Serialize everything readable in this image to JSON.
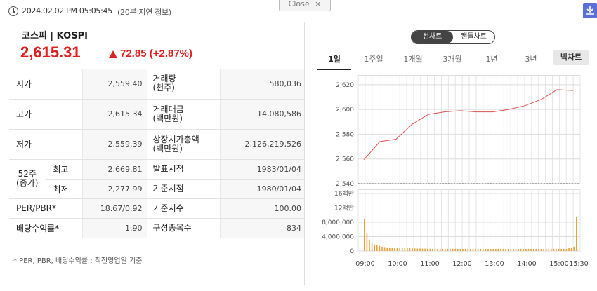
{
  "header": {
    "timestamp": "2024.02.02 PM 05:05:45",
    "delay_note": "(20분 지연 정보)",
    "close_label": "Close",
    "close_glyph": "×"
  },
  "index": {
    "name": "코스피 | KOSPI",
    "value": "2,615.31",
    "change": "72.85",
    "change_pct": "(+2.87%)",
    "up_color": "#e02020"
  },
  "stats": {
    "open_label": "시가",
    "open_value": "2,559.40",
    "volume_label": "거래량\n(천주)",
    "volume_value": "580,036",
    "high_label": "고가",
    "high_value": "2,615.34",
    "amount_label": "거래대금\n(백만원)",
    "amount_value": "14,080,586",
    "low_label": "저가",
    "low_value": "2,559.39",
    "mcap_label": "상장시가총액\n(백만원)",
    "mcap_value": "2,126,219,526",
    "week52_label": "52주\n(종가)",
    "w52_high_label": "최고",
    "w52_high_value": "2,669.81",
    "announce_label": "발표시점",
    "announce_value": "1983/01/04",
    "w52_low_label": "최저",
    "w52_low_value": "2,277.99",
    "base_time_label": "기준시점",
    "base_time_value": "1980/01/04",
    "per_label": "PER/PBR*",
    "per_value": "18.67/0.92",
    "base_index_label": "기준지수",
    "base_index_value": "100.00",
    "div_label": "배당수익률*",
    "div_value": "1.90",
    "constituents_label": "구성종목수",
    "constituents_value": "834"
  },
  "footnote": "* PER, PBR, 배당수익률 : 직전영업일 기준",
  "chart_controls": {
    "line_chart": "선차트",
    "candle_chart": "캔들차트",
    "periods": [
      "1일",
      "1주일",
      "1개월",
      "3개월",
      "1년",
      "3년"
    ],
    "big_chart": "빅차트"
  },
  "chart_data": [
    {
      "type": "line",
      "title": "",
      "x": [
        "09:00",
        "09:30",
        "10:00",
        "10:30",
        "11:00",
        "11:30",
        "12:00",
        "12:30",
        "13:00",
        "13:30",
        "14:00",
        "14:30",
        "15:00",
        "15:30"
      ],
      "xticks": [
        "09:00",
        "10:00",
        "11:00",
        "12:00",
        "13:00",
        "14:00",
        "15:00",
        "15:30"
      ],
      "series": [
        {
          "values": [
            2559.4,
            2574,
            2576,
            2588,
            2596,
            2598,
            2599,
            2598,
            2598,
            2600,
            2603,
            2608,
            2616,
            2615.31
          ]
        }
      ],
      "yticks": [
        "2,540",
        "2,560",
        "2,580",
        "2,600",
        "2,620"
      ],
      "ylim": [
        2540,
        2625
      ],
      "color": "#d9534f",
      "grid": true
    },
    {
      "type": "bar",
      "title": "",
      "yticks": [
        "0",
        "4,000,000",
        "8,000,000",
        "12백만",
        "16백만"
      ],
      "ylim": [
        0,
        16000000
      ],
      "values": [
        9000000,
        5000000,
        3200000,
        2200000,
        1800000,
        1600000,
        1400000,
        1200000,
        1100000,
        1000000,
        950000,
        900000,
        880000,
        850000,
        820000,
        800000,
        780000,
        760000,
        740000,
        720000,
        700000,
        690000,
        680000,
        670000,
        660000,
        650000,
        640000,
        630000,
        620000,
        610000,
        600000,
        600000,
        600000,
        600000,
        600000,
        600000,
        600000,
        600000,
        600000,
        600000,
        600000,
        600000,
        600000,
        600000,
        600000,
        600000,
        600000,
        600000,
        600000,
        600000,
        600000,
        600000,
        600000,
        600000,
        600000,
        600000,
        600000,
        600000,
        600000,
        600000,
        600000,
        600000,
        600000,
        600000,
        600000,
        600000,
        600000,
        600000,
        600000,
        600000,
        600000,
        600000,
        600000,
        600000,
        600000,
        600000,
        600000,
        600000,
        600000,
        600000,
        600000,
        800000,
        1000000,
        1200000,
        9500000
      ],
      "color": "#e8a33c",
      "grid": true
    }
  ]
}
